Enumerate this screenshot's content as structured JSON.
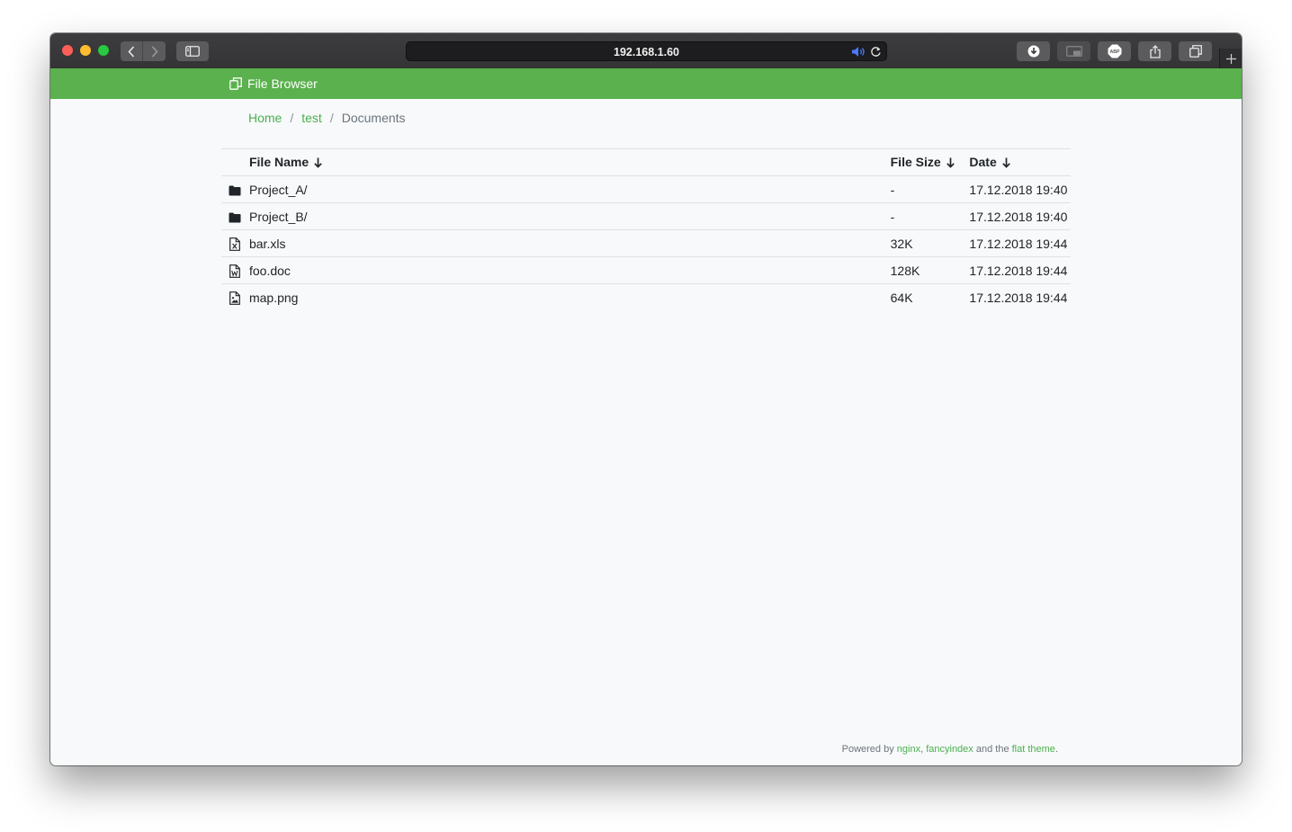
{
  "browser": {
    "url": "192.168.1.60"
  },
  "navbar": {
    "brand_label": "File Browser",
    "accent_color": "#5ab14d"
  },
  "breadcrumb": {
    "items": [
      "Home",
      "test"
    ],
    "separator": "/",
    "current": "Documents"
  },
  "table": {
    "columns": {
      "name": "File Name",
      "size": "File Size",
      "date": "Date"
    },
    "sort_arrow": "↓",
    "rows": [
      {
        "icon": "folder-icon",
        "name": "Project_A/",
        "size": "-",
        "date": "17.12.2018 19:40"
      },
      {
        "icon": "folder-icon",
        "name": "Project_B/",
        "size": "-",
        "date": "17.12.2018 19:40"
      },
      {
        "icon": "spreadsheet-file-icon",
        "name": "bar.xls",
        "size": "32K",
        "date": "17.12.2018 19:44"
      },
      {
        "icon": "word-file-icon",
        "name": "foo.doc",
        "size": "128K",
        "date": "17.12.2018 19:44"
      },
      {
        "icon": "image-file-icon",
        "name": "map.png",
        "size": "64K",
        "date": "17.12.2018 19:44"
      }
    ]
  },
  "footer": {
    "powered_by": "Powered by",
    "nginx": "nginx",
    "comma": ",",
    "fancyindex": "fancyindex",
    "and_the": "and the",
    "flat_theme": "flat theme",
    "period": "."
  }
}
